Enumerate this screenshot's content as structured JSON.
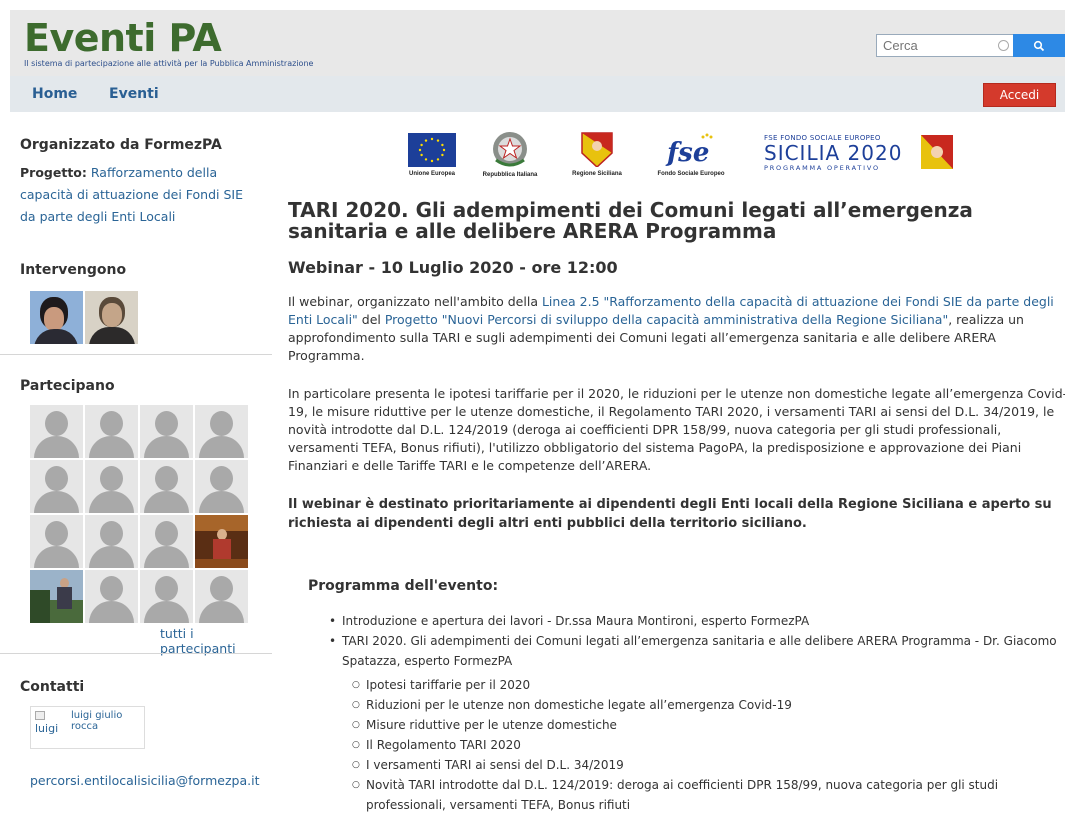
{
  "header": {
    "title": "Eventi PA",
    "subtitle": "Il sistema di partecipazione alle attività per la Pubblica Amministrazione",
    "search_placeholder": "Cerca",
    "search_icon": "search-icon"
  },
  "nav": {
    "home": "Home",
    "eventi": "Eventi",
    "accedi": "Accedi"
  },
  "sidebar": {
    "organizzato_heading": "Organizzato da FormezPA",
    "progetto_label": "Progetto:",
    "progetto_link": "Rafforzamento della capacità di attuazione dei Fondi SIE da parte degli Enti Locali",
    "intervengono_heading": "Intervengono",
    "partecipano_heading": "Partecipano",
    "tutti_link": "tutti i partecipanti",
    "contatti_heading": "Contatti",
    "contact_img_alt": "luigi",
    "contact_name": "luigi giulio rocca",
    "email": "percorsi.entilocalisicilia@formezpa.it"
  },
  "logos": {
    "ue": "Unione Europea",
    "ri": "Repubblica Italiana",
    "rs": "Regione Siciliana",
    "fse": "Fondo Sociale Europeo",
    "fse_top": "FSE FONDO SOCIALE EUROPEO",
    "sicilia": "SICILIA 2020",
    "programma": "PROGRAMMA OPERATIVO"
  },
  "event": {
    "title": "TARI 2020. Gli adempimenti dei Comuni legati all’emergenza sanitaria e alle delibere ARERA Programma",
    "subtitle": "Webinar - 10 Luglio 2020 - ore 12:00",
    "p1_a": "Il webinar, organizzato nell'ambito della ",
    "p1_link1": "Linea 2.5 \"Rafforzamento della capacità di attuazione dei Fondi SIE da parte degli Enti Locali\"",
    "p1_b": " del ",
    "p1_link2": "Progetto \"Nuovi Percorsi di sviluppo della capacità amministrativa della Regione Siciliana\"",
    "p1_c": ", realizza un approfondimento sulla TARI e sugli adempimenti dei Comuni legati all’emergenza sanitaria e alle delibere ARERA Programma.",
    "p2": "In particolare presenta le ipotesi tariffarie per il 2020, le riduzioni per le utenze non domestiche legate all’emergenza Covid-19, le misure riduttive per le utenze domestiche, il Regolamento TARI 2020, i versamenti TARI ai sensi del D.L. 34/2019, le novità introdotte dal D.L. 124/2019 (deroga ai coefficienti DPR 158/99, nuova categoria per gli studi professionali, versamenti TEFA, Bonus rifiuti), l'utilizzo obbligatorio del sistema PagoPA, la predisposizione e approvazione dei Piani Finanziari e delle Tariffe TARI e le competenze dell’ARERA.",
    "p3": "Il webinar è destinato prioritariamente ai dipendenti degli Enti locali della Regione Siciliana e aperto su richiesta ai dipendenti degli altri enti pubblici della territorio siciliano.",
    "programma_heading": "Programma dell'evento:",
    "items": [
      "Introduzione e apertura dei lavori - Dr.ssa Maura Montironi,  esperto FormezPA",
      "TARI 2020. Gli adempimenti dei Comuni legati all’emergenza sanitaria e alle delibere ARERA Programma - Dr. Giacomo Spatazza, esperto FormezPA"
    ],
    "subitems": [
      "Ipotesi tariffarie per il 2020",
      "Riduzioni per le utenze non domestiche legate all’emergenza Covid-19",
      "Misure riduttive per le utenze domestiche",
      "Il Regolamento TARI 2020",
      "I versamenti TARI ai sensi del D.L. 34/2019",
      "Novità TARI introdotte dal D.L. 124/2019: deroga ai coefficienti DPR 158/99, nuova categoria per gli studi professionali, versamenti TEFA, Bonus rifiuti"
    ]
  }
}
